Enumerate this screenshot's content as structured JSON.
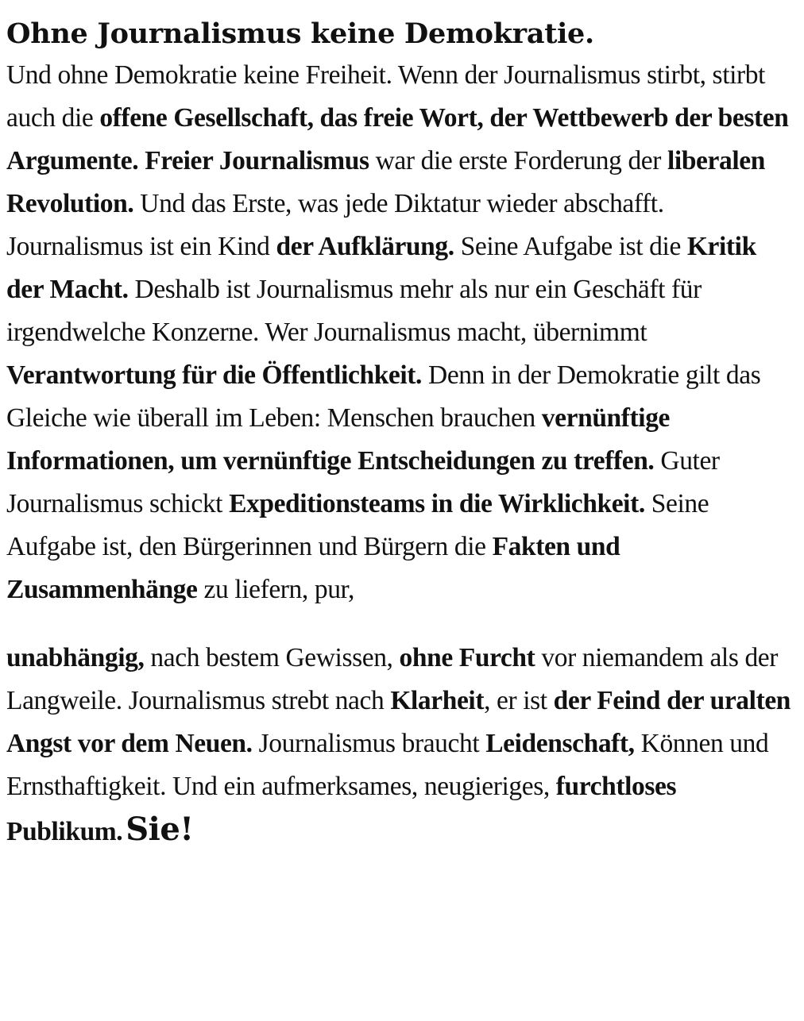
{
  "heading": "Ohne Journalismus keine Demokratie.",
  "paragraph1": [
    {
      "t": "Und ohne Demokratie keine Freiheit. Wenn der Journalismus stirbt, stirbt auch die ",
      "b": false
    },
    {
      "t": "offene Gesellschaft, das freie Wort, der Wettbewerb der besten Argumente. Freier Journalismus",
      "b": true
    },
    {
      "t": " war die erste Forderung der ",
      "b": false
    },
    {
      "t": "liberalen Revolution.",
      "b": true
    },
    {
      "t": " Und das Erste, was jede Diktatur wieder abschafft. Journalismus ist ein Kind ",
      "b": false
    },
    {
      "t": "der Aufklärung.",
      "b": true
    },
    {
      "t": " Seine Aufgabe ist die ",
      "b": false
    },
    {
      "t": "Kritik der Macht.",
      "b": true
    },
    {
      "t": " Deshalb ist Journalismus mehr als nur ein Geschäft für irgendwelche Konzerne. Wer Journalismus macht, übernimmt ",
      "b": false
    },
    {
      "t": "Verantwortung für die Öffentlichkeit.",
      "b": true
    },
    {
      "t": " Denn in der Demokratie gilt das Gleiche wie überall im Leben: Menschen brauchen ",
      "b": false
    },
    {
      "t": "vernünftige Informationen, um vernünftige Entscheidungen zu treffen.",
      "b": true
    },
    {
      "t": " Guter Journalismus schickt ",
      "b": false
    },
    {
      "t": "Expeditionsteams in die Wirklichkeit.",
      "b": true
    },
    {
      "t": " Seine Aufgabe ist, den Bürgerinnen und Bürgern die ",
      "b": false
    },
    {
      "t": "Fakten und Zusammenhänge",
      "b": true
    },
    {
      "t": " zu liefern, pur,",
      "b": false
    }
  ],
  "paragraph2": [
    {
      "t": "unabhängig,",
      "b": true
    },
    {
      "t": " nach bestem Gewissen, ",
      "b": false
    },
    {
      "t": "ohne Furcht",
      "b": true
    },
    {
      "t": " vor niemandem als der Langweile. Journalismus strebt nach ",
      "b": false
    },
    {
      "t": "Klarheit",
      "b": true
    },
    {
      "t": ", er ist ",
      "b": false
    },
    {
      "t": "der Feind der uralten Angst vor dem Neuen.",
      "b": true
    },
    {
      "t": " Journalismus braucht ",
      "b": false
    },
    {
      "t": "Leidenschaft,",
      "b": true
    },
    {
      "t": " Können und Ernsthaftigkeit. Und ein aufmerksames, neugieriges, ",
      "b": false
    },
    {
      "t": "furchtloses Publikum.",
      "b": true
    }
  ],
  "closing": "Sie!"
}
